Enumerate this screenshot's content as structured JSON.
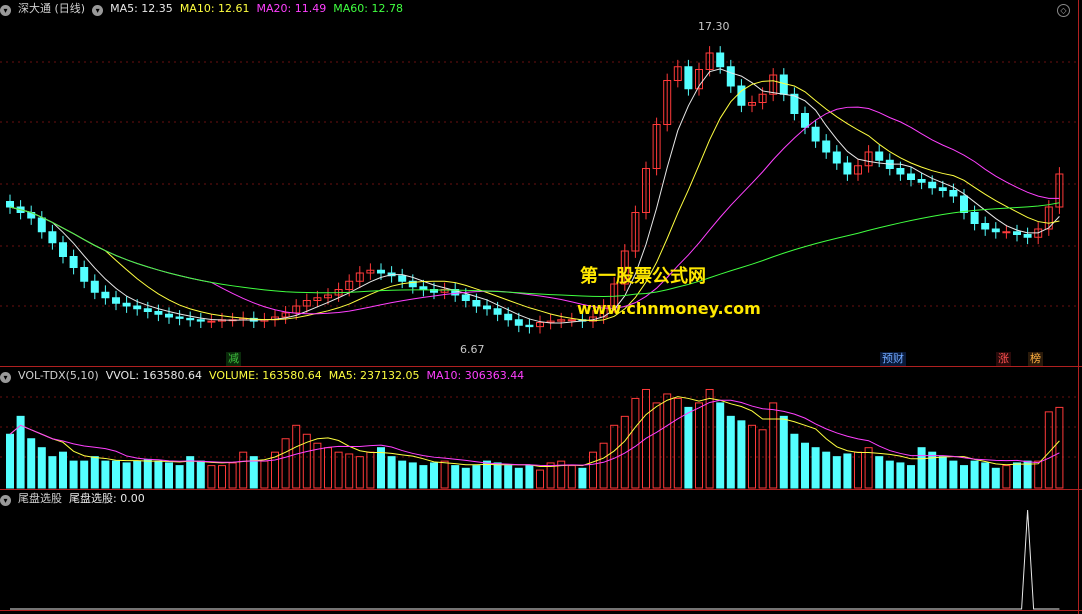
{
  "main": {
    "title": "深大通 (日线)",
    "ma5": "MA5: 12.35",
    "ma10": "MA10: 12.61",
    "ma20": "MA20: 11.49",
    "ma60": "MA60: 12.78",
    "high_label": "17.30",
    "low_label": "6.67",
    "flags": [
      {
        "text": "减",
        "color": "#3fbf3f",
        "bg": "#0a2a0a"
      },
      {
        "text": "预财",
        "color": "#6fa8ff",
        "bg": "#0a1a3a"
      },
      {
        "text": "涨",
        "color": "#ff5050",
        "bg": "#2a0a0a"
      },
      {
        "text": "榜",
        "color": "#ffb040",
        "bg": "#2a1a0a"
      }
    ]
  },
  "watermark": {
    "line1": "第一股票公式网",
    "line2": "www.chnmoney.com"
  },
  "volume": {
    "title": "VOL-TDX(5,10)",
    "vvol": "VVOL: 163580.64",
    "volume": "VOLUME: 163580.64",
    "ma5": "MA5: 237132.05",
    "ma10": "MA10: 306363.44"
  },
  "indicator": {
    "title": "尾盘选股",
    "value": "尾盘选股: 0.00"
  },
  "colors": {
    "up": "#ff3a3a",
    "down": "#54ffff",
    "ma5": "#e8e8e8",
    "ma10": "#ffff40",
    "ma20": "#ff40ff",
    "ma60": "#40ff40"
  },
  "chart_data": {
    "type": "candlestick",
    "n": 100,
    "closes": [
      11.2,
      11.0,
      10.8,
      10.3,
      9.9,
      9.4,
      9.0,
      8.5,
      8.1,
      7.9,
      7.7,
      7.6,
      7.5,
      7.4,
      7.3,
      7.2,
      7.15,
      7.1,
      7.05,
      7.05,
      7.1,
      7.1,
      7.15,
      7.05,
      7.1,
      7.2,
      7.35,
      7.6,
      7.8,
      7.9,
      8.0,
      8.2,
      8.5,
      8.8,
      8.9,
      8.8,
      8.7,
      8.5,
      8.3,
      8.2,
      8.1,
      8.2,
      8.0,
      7.8,
      7.6,
      7.5,
      7.3,
      7.1,
      6.9,
      6.85,
      7.0,
      7.05,
      7.1,
      7.1,
      7.05,
      7.2,
      7.6,
      8.4,
      9.6,
      11.0,
      12.6,
      14.2,
      15.8,
      16.3,
      15.5,
      16.2,
      16.8,
      16.3,
      15.6,
      14.9,
      15.0,
      15.3,
      16.0,
      15.3,
      14.6,
      14.1,
      13.6,
      13.2,
      12.8,
      12.4,
      12.7,
      13.2,
      12.9,
      12.6,
      12.4,
      12.2,
      12.1,
      11.9,
      11.8,
      11.6,
      11.0,
      10.6,
      10.4,
      10.3,
      10.3,
      10.2,
      10.1,
      10.4,
      11.2,
      12.4
    ],
    "volumes": [
      60,
      80,
      55,
      45,
      35,
      40,
      30,
      30,
      35,
      30,
      30,
      28,
      30,
      32,
      30,
      28,
      25,
      35,
      30,
      25,
      25,
      28,
      40,
      35,
      30,
      40,
      55,
      70,
      60,
      50,
      45,
      40,
      38,
      35,
      40,
      45,
      35,
      30,
      28,
      25,
      28,
      30,
      25,
      22,
      25,
      30,
      28,
      25,
      22,
      25,
      20,
      28,
      30,
      25,
      22,
      40,
      50,
      70,
      80,
      100,
      110,
      95,
      105,
      100,
      90,
      95,
      110,
      95,
      80,
      75,
      70,
      65,
      95,
      80,
      60,
      50,
      45,
      40,
      35,
      38,
      40,
      45,
      35,
      30,
      28,
      25,
      45,
      40,
      35,
      30,
      25,
      30,
      28,
      22,
      25,
      28,
      30,
      30,
      85,
      90
    ],
    "signal_index": 96
  }
}
